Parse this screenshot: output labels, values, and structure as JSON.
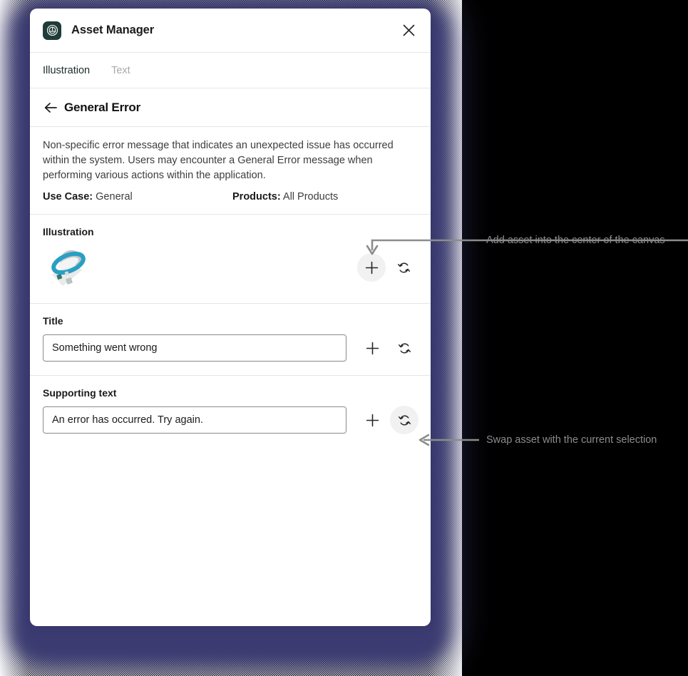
{
  "window": {
    "app_title": "Asset Manager",
    "app_icon": "asset-manager-logo-icon",
    "close_icon": "close-icon"
  },
  "tabs": [
    {
      "label": "Illustration",
      "active": true
    },
    {
      "label": "Text",
      "active": false
    }
  ],
  "asset": {
    "back_icon": "back-arrow-icon",
    "name": "General Error",
    "description": "Non-specific error message that indicates an unexpected issue has occurred within the system. Users may encounter a General Error message when performing various actions within the application.",
    "meta": {
      "use_case_key": "Use Case:",
      "use_case_value": "General",
      "products_key": "Products:",
      "products_value": "All Products"
    }
  },
  "sections": {
    "illustration": {
      "label": "Illustration",
      "art_name": "ufo-flying-saucer-illustration",
      "add_icon": "plus-icon",
      "swap_icon": "swap-refresh-icon"
    },
    "title": {
      "label": "Title",
      "value": "Something went wrong",
      "placeholder": "Title",
      "add_icon": "plus-icon",
      "swap_icon": "swap-refresh-icon"
    },
    "supporting_text": {
      "label": "Supporting text",
      "value": "An error has occurred. Try again.",
      "placeholder": "Supporting text",
      "add_icon": "plus-icon",
      "swap_icon": "swap-refresh-icon"
    }
  },
  "annotations": [
    {
      "text": "Add asset into the center of the canvas",
      "target": "illustration-add-button"
    },
    {
      "text": "Swap asset with the current selection",
      "target": "supporting-text-swap-button"
    }
  ],
  "colors": {
    "panel_glow": "#3b3b72",
    "app_icon_bg": "#1f3c38",
    "illustration_accent": "#2a9fc4",
    "annotation_text": "#8c8c8c",
    "tab_inactive": "#a9a9a9",
    "button_filled_bg": "#f1f1f1"
  }
}
